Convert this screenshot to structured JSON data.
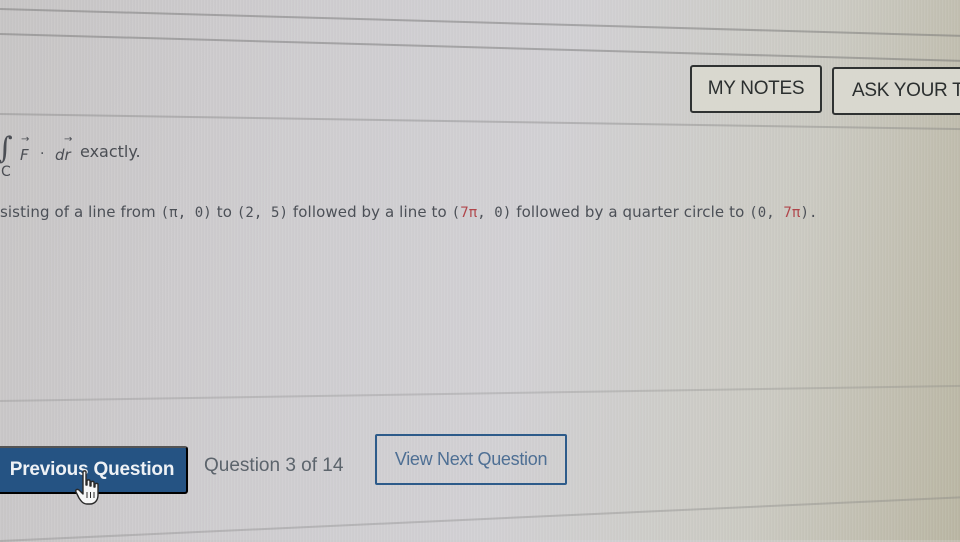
{
  "toolbar": {
    "my_notes_label": "MY NOTES",
    "ask_teacher_label": "ASK YOUR TE"
  },
  "question": {
    "integral_subscript": "C",
    "vector_f": "F",
    "vector_r": "dr",
    "arrow_glyph": "→",
    "dot_operator": "·",
    "prompt_tail": "exactly.",
    "curve_prefix": "sisting of a line from ",
    "point_1": "(π, 0)",
    "connector_1": " to ",
    "point_2": "(2, 5)",
    "connector_2": " followed by a line to ",
    "point_3_open": "(",
    "point_3_pi": "7π",
    "point_3_close": ", 0)",
    "connector_3": " followed by a quarter circle to ",
    "point_4_open": "(0, ",
    "point_4_pi": "7π",
    "point_4_close": ").",
    "highlight_color": "#b0454a"
  },
  "navigation": {
    "previous_label": "Previous Question",
    "counter_text": "Question 3 of 14",
    "current_question": 3,
    "total_questions": 14,
    "next_label": "View Next Question",
    "primary_color": "#255383"
  },
  "cursor": {
    "icon": "hand-pointer-icon"
  }
}
